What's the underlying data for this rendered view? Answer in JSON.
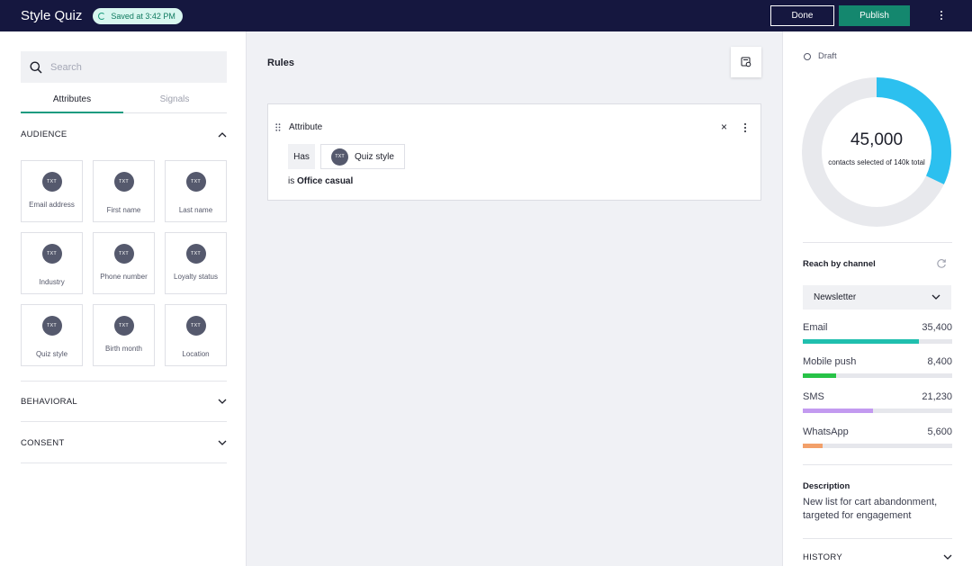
{
  "header": {
    "title": "Style Quiz",
    "saved": "Saved at 3:42 PM",
    "done_label": "Done",
    "publish_label": "Publish"
  },
  "left": {
    "search_placeholder": "Search",
    "tabs": [
      "Attributes",
      "Signals"
    ],
    "sections": {
      "audience": "AUDIENCE",
      "behavioral": "BEHAVIORAL",
      "consent": "CONSENT"
    },
    "badge": "TXT",
    "tiles": [
      {
        "label": "Email address"
      },
      {
        "label": "First name"
      },
      {
        "label": "Last name"
      },
      {
        "label": "Industry"
      },
      {
        "label": "Phone number"
      },
      {
        "label": "Loyalty status"
      },
      {
        "label": "Quiz style"
      },
      {
        "label": "Birth month"
      },
      {
        "label": "Location"
      }
    ]
  },
  "center": {
    "title": "Rules",
    "rule": {
      "type": "Attribute",
      "operator": "Has",
      "attribute": "Quiz style",
      "condition_prefix": "is",
      "condition_value": "Office casual"
    }
  },
  "right": {
    "status": "Draft",
    "count": "45,000",
    "count_sub": "contacts selected of 140k total",
    "selected_fraction": 0.321,
    "reach_title": "Reach by channel",
    "channel_select": "Newsletter",
    "channels": [
      {
        "name": "Email",
        "value": "35,400",
        "fraction": 0.78,
        "color": "#20bfae"
      },
      {
        "name": "Mobile push",
        "value": "8,400",
        "fraction": 0.22,
        "color": "#27c247"
      },
      {
        "name": "SMS",
        "value": "21,230",
        "fraction": 0.47,
        "color": "#c39af0"
      },
      {
        "name": "WhatsApp",
        "value": "5,600",
        "fraction": 0.13,
        "color": "#f2a06a"
      }
    ],
    "description_title": "Description",
    "description": "New list for cart abandonment, targeted for engagement",
    "history": "HISTORY",
    "colors": {
      "donut": "#2cc0ef",
      "donut_track": "#e8e9ed"
    }
  }
}
